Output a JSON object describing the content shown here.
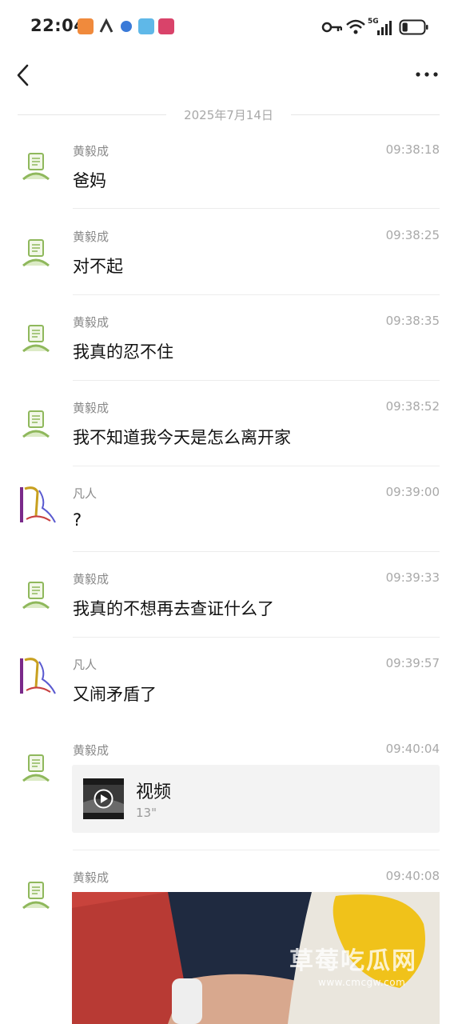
{
  "status_bar": {
    "time": "22:04",
    "network": "5G",
    "battery_level": 0.25
  },
  "date_separator": "2025年7月14日",
  "messages": [
    {
      "sender": "黄毅成",
      "time": "09:38:18",
      "text": "爸妈"
    },
    {
      "sender": "黄毅成",
      "time": "09:38:25",
      "text": "对不起"
    },
    {
      "sender": "黄毅成",
      "time": "09:38:35",
      "text": "我真的忍不住"
    },
    {
      "sender": "黄毅成",
      "time": "09:38:52",
      "text": "我不知道我今天是怎么离开家"
    },
    {
      "sender": "凡人",
      "time": "09:39:00",
      "text": "?"
    },
    {
      "sender": "黄毅成",
      "time": "09:39:33",
      "text": "我真的不想再去查证什么了"
    },
    {
      "sender": "凡人",
      "time": "09:39:57",
      "text": "又闹矛盾了"
    },
    {
      "sender": "黄毅成",
      "time": "09:40:04",
      "video": {
        "title": "视频",
        "duration": "13\""
      }
    },
    {
      "sender": "黄毅成",
      "time": "09:40:08",
      "image": true
    }
  ],
  "watermark": {
    "text": "草莓吃瓜网",
    "url": "www.cmcgw.com"
  },
  "icons": {
    "back": "chevron-left-icon",
    "more": "more-horizontal-icon",
    "avatar_huang": "doodle-avatar-icon",
    "avatar_fanren": "abstract-avatar-icon",
    "play": "play-icon"
  },
  "colors": {
    "background": "#ffffff",
    "sender_text": "#8a8a8a",
    "time_text": "#a9a9a9",
    "video_card_bg": "#f3f3f3"
  }
}
